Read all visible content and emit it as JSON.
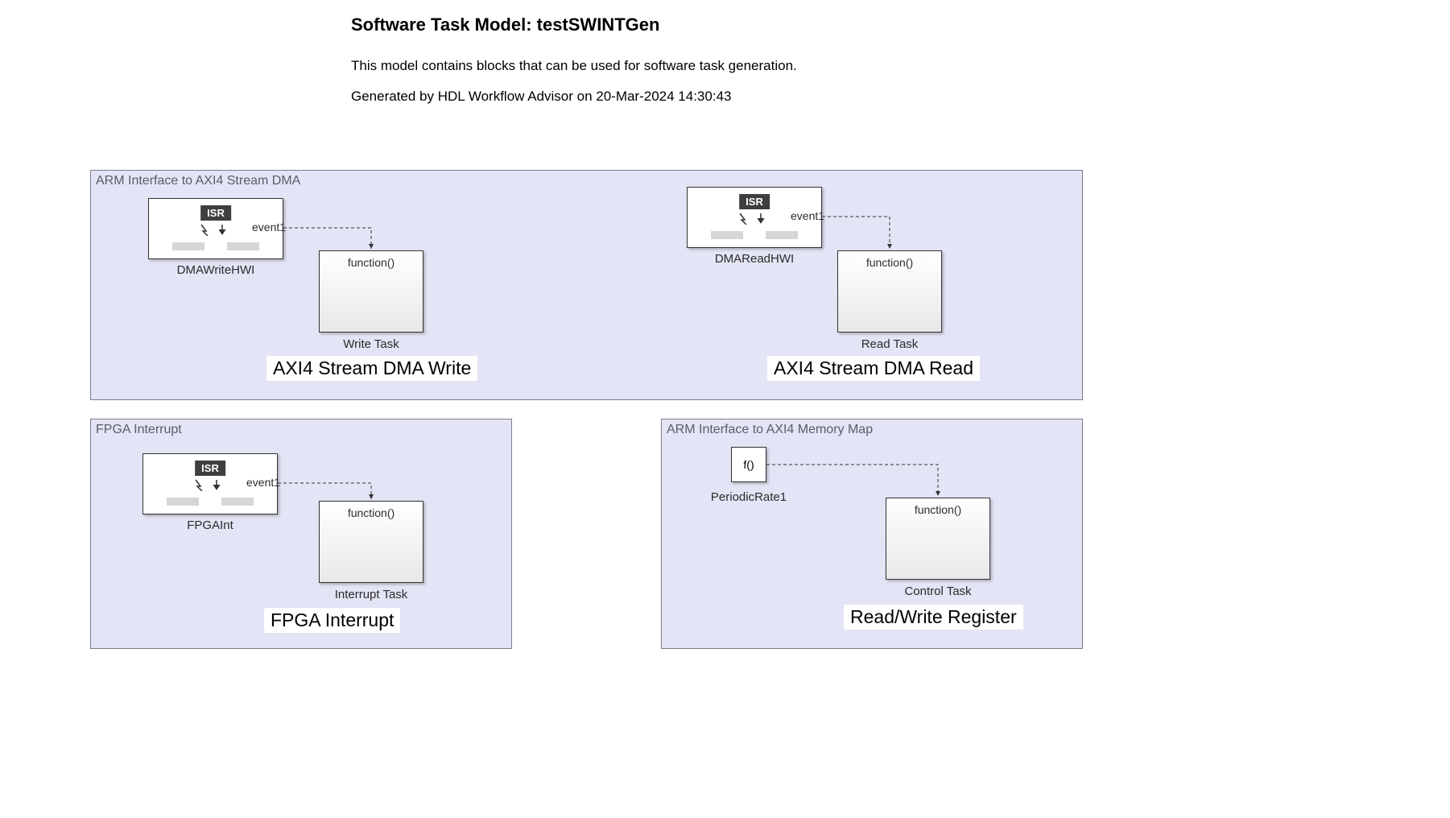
{
  "header": {
    "title": "Software Task Model: testSWINTGen",
    "description": "This model contains blocks that can be used for software task generation.",
    "generated": "Generated by HDL Workflow Advisor on 20-Mar-2024 14:30:43"
  },
  "region_top": {
    "label": "ARM Interface to AXI4 Stream DMA",
    "left": {
      "isr_badge": "ISR",
      "isr_name": "DMAWriteHWI",
      "port": "event1",
      "func_text": "function()",
      "func_name": "Write Task",
      "subtitle": "AXI4 Stream DMA Write"
    },
    "right": {
      "isr_badge": "ISR",
      "isr_name": "DMAReadHWI",
      "port": "event1",
      "func_text": "function()",
      "func_name": "Read Task",
      "subtitle": "AXI4 Stream DMA Read"
    }
  },
  "region_bl": {
    "label": "FPGA Interrupt",
    "isr_badge": "ISR",
    "isr_name": "FPGAInt",
    "port": "event1",
    "func_text": "function()",
    "func_name": "Interrupt Task",
    "subtitle": "FPGA Interrupt"
  },
  "region_br": {
    "label": "ARM Interface to AXI4 Memory Map",
    "fcall_text": "f()",
    "fcall_name": "PeriodicRate1",
    "func_text": "function()",
    "func_name": "Control Task",
    "subtitle": "Read/Write Register"
  }
}
